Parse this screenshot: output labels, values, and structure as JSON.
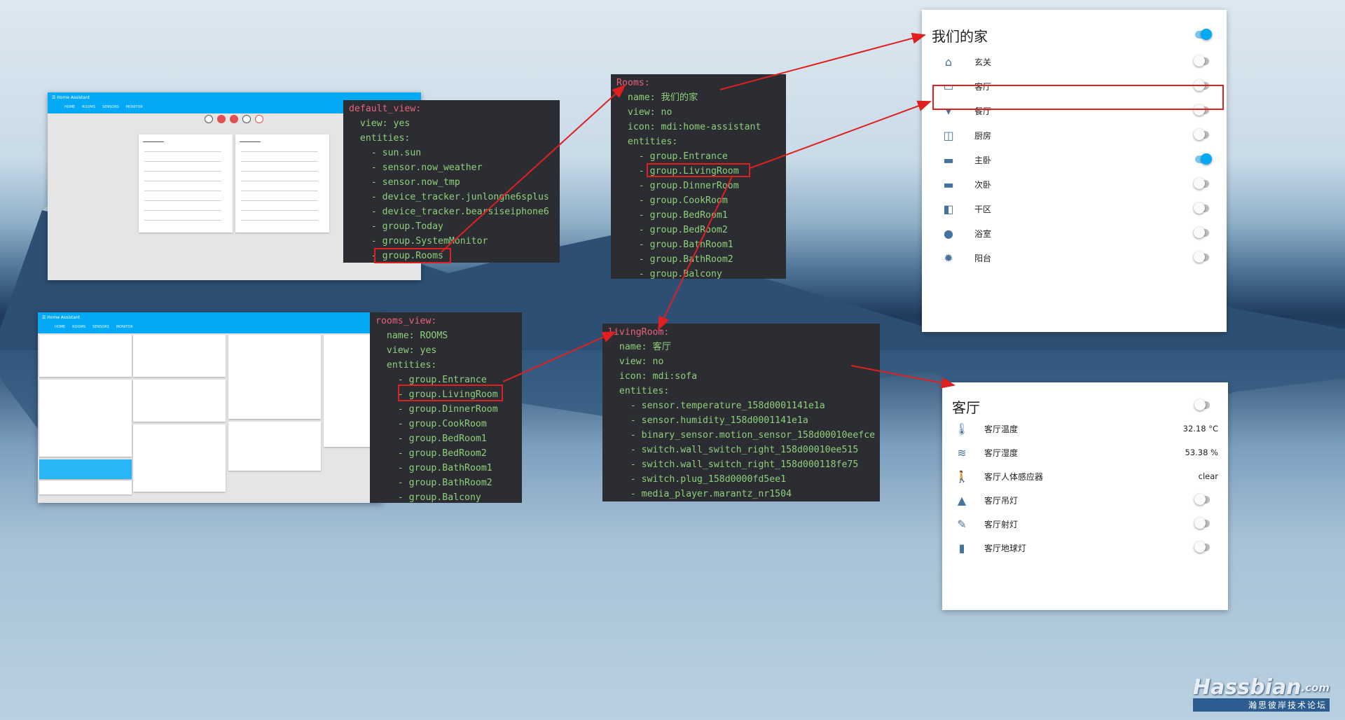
{
  "code_default": {
    "lines": [
      [
        "k",
        "default_view:"
      ],
      [
        "",
        "  view: yes"
      ],
      [
        "",
        "  entities:"
      ],
      [
        "",
        "    - sun.sun"
      ],
      [
        "",
        "    - sensor.now_weather"
      ],
      [
        "",
        "    - sensor.now_tmp"
      ],
      [
        "",
        "    - device_tracker.junlongne6splus"
      ],
      [
        "",
        "    - device_tracker.bearsiseiphone6"
      ],
      [
        "",
        "    - group.Today"
      ],
      [
        "",
        "    - group.SystemMonitor"
      ],
      [
        "",
        "    - group.Rooms"
      ]
    ]
  },
  "code_rooms": {
    "lines": [
      [
        "k",
        "Rooms:"
      ],
      [
        "",
        "  name: 我们的家"
      ],
      [
        "",
        "  view: no"
      ],
      [
        "",
        "  icon: mdi:home-assistant"
      ],
      [
        "",
        "  entities:"
      ],
      [
        "",
        "    - group.Entrance"
      ],
      [
        "",
        "    - group.LivingRoom"
      ],
      [
        "",
        "    - group.DinnerRoom"
      ],
      [
        "",
        "    - group.CookRoom"
      ],
      [
        "",
        "    - group.BedRoom1"
      ],
      [
        "",
        "    - group.BedRoom2"
      ],
      [
        "",
        "    - group.BathRoom1"
      ],
      [
        "",
        "    - group.BathRoom2"
      ],
      [
        "",
        "    - group.Balcony"
      ]
    ]
  },
  "code_roomsview": {
    "lines": [
      [
        "k",
        "rooms_view:"
      ],
      [
        "",
        "  name: ROOMS"
      ],
      [
        "",
        "  view: yes"
      ],
      [
        "",
        "  entities:"
      ],
      [
        "",
        "    - group.Entrance"
      ],
      [
        "",
        "    - group.LivingRoom"
      ],
      [
        "",
        "    - group.DinnerRoom"
      ],
      [
        "",
        "    - group.CookRoom"
      ],
      [
        "",
        "    - group.BedRoom1"
      ],
      [
        "",
        "    - group.BedRoom2"
      ],
      [
        "",
        "    - group.BathRoom1"
      ],
      [
        "",
        "    - group.BathRoom2"
      ],
      [
        "",
        "    - group.Balcony"
      ]
    ]
  },
  "code_living": {
    "lines": [
      [
        "k",
        "livingRoom:"
      ],
      [
        "",
        "  name: 客厅"
      ],
      [
        "",
        "  view: no"
      ],
      [
        "",
        "  icon: mdi:sofa"
      ],
      [
        "",
        "  entities:"
      ],
      [
        "",
        "    - sensor.temperature_158d0001141e1a"
      ],
      [
        "",
        "    - sensor.humidity_158d0001141e1a"
      ],
      [
        "",
        "    - binary_sensor.motion_sensor_158d00010eefce"
      ],
      [
        "",
        "    - switch.wall_switch_right_158d00010ee515"
      ],
      [
        "",
        "    - switch.wall_switch_right_158d000118fe75"
      ],
      [
        "",
        "    - switch.plug_158d0000fd5ee1"
      ],
      [
        "",
        "    - media_player.marantz_nr1504"
      ]
    ]
  },
  "home_card": {
    "title": "我们的家",
    "toggle_on": true,
    "items": [
      {
        "icon": "home-icon",
        "glyph": "⌂",
        "label": "玄关",
        "on": false
      },
      {
        "icon": "sofa-icon",
        "glyph": "▭",
        "label": "客厅",
        "on": false
      },
      {
        "icon": "glass-icon",
        "glyph": "▾",
        "label": "餐厅",
        "on": false
      },
      {
        "icon": "pot-icon",
        "glyph": "◫",
        "label": "厨房",
        "on": false
      },
      {
        "icon": "bed-icon",
        "glyph": "▬",
        "label": "主卧",
        "on": true
      },
      {
        "icon": "bed-icon",
        "glyph": "▬",
        "label": "次卧",
        "on": false
      },
      {
        "icon": "dryer-icon",
        "glyph": "◧",
        "label": "干区",
        "on": false
      },
      {
        "icon": "drop-icon",
        "glyph": "●",
        "label": "浴室",
        "on": false
      },
      {
        "icon": "sun-icon",
        "glyph": "✹",
        "label": "阳台",
        "on": false
      }
    ]
  },
  "living_card": {
    "title": "客厅",
    "toggle_on": false,
    "items": [
      {
        "icon": "thermometer-icon",
        "glyph": "🌡",
        "label": "客厅温度",
        "value": "32.18 °C"
      },
      {
        "icon": "humidity-icon",
        "glyph": "≋",
        "label": "客厅湿度",
        "value": "53.38 %"
      },
      {
        "icon": "walk-icon",
        "glyph": "🚶",
        "label": "客厅人体感应器",
        "value": "clear"
      },
      {
        "icon": "ceiling-light-icon",
        "glyph": "▲",
        "label": "客厅吊灯",
        "toggle": true
      },
      {
        "icon": "spotlight-icon",
        "glyph": "✎",
        "label": "客厅射灯",
        "toggle": true
      },
      {
        "icon": "lamp-icon",
        "glyph": "▮",
        "label": "客厅地球灯",
        "toggle": true
      }
    ]
  },
  "logo": {
    "text": "Hassbian",
    "suffix": ".com",
    "tagline": "瀚思彼岸技术论坛"
  },
  "colors": {
    "accent": "#03a9f4",
    "icon": "#44739e",
    "highlight": "#e02020",
    "code_bg": "#2b2d33"
  }
}
